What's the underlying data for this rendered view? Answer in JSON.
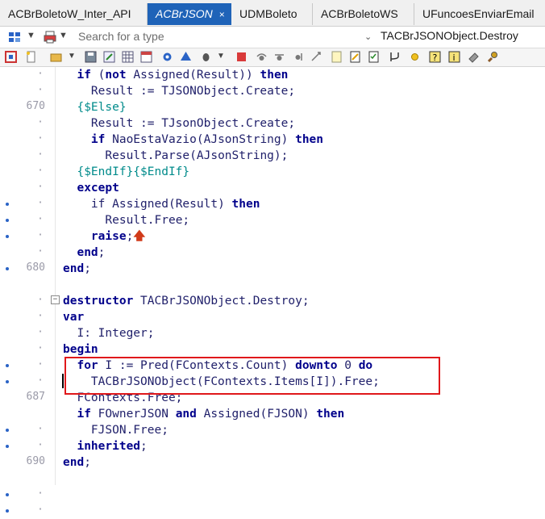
{
  "tabs": [
    {
      "label": "ACBrBoletoW_Inter_API",
      "active": false
    },
    {
      "label": "ACBrJSON",
      "active": true,
      "close": "×"
    },
    {
      "label": "UDMBoleto",
      "active": false
    },
    {
      "label": "ACBrBoletoWS",
      "active": false
    },
    {
      "label": "UFuncoesEnviarEmail",
      "active": false
    }
  ],
  "search": {
    "placeholder": "Search for a type"
  },
  "method_selector": {
    "value": "TACBrJSONObject.Destroy"
  },
  "colors": {
    "tab_active": "#1f63b8",
    "highlight_box": "#e0181b",
    "keyword": "#00008b",
    "directive": "#008b8b"
  },
  "gutter": [
    {
      "num": "",
      "dot": false
    },
    {
      "num": "",
      "dot": false
    },
    {
      "num": "670",
      "dot": false
    },
    {
      "num": "",
      "dot": false
    },
    {
      "num": "",
      "dot": false
    },
    {
      "num": "",
      "dot": false
    },
    {
      "num": "",
      "dot": false
    },
    {
      "num": "",
      "dot": false
    },
    {
      "num": "",
      "dot": true
    },
    {
      "num": "",
      "dot": true
    },
    {
      "num": "",
      "dot": true
    },
    {
      "num": "",
      "dot": false
    },
    {
      "num": "680",
      "dot": true
    },
    {
      "num": "",
      "dot": false
    },
    {
      "num": "",
      "dot": false
    },
    {
      "num": "",
      "dot": false
    },
    {
      "num": "",
      "dot": false
    },
    {
      "num": "",
      "dot": true
    },
    {
      "num": "",
      "dot": true
    },
    {
      "num": "687",
      "dot": false
    },
    {
      "num": "",
      "dot": true
    },
    {
      "num": "",
      "dot": true
    },
    {
      "num": "690",
      "dot": false
    },
    {
      "num": "",
      "dot": true
    },
    {
      "num": "",
      "dot": true
    }
  ],
  "code": {
    "l1": {
      "indent": "  ",
      "a": "if",
      "b": " (",
      "c": "not",
      "d": " Assigned(Result)) ",
      "e": "then"
    },
    "l2": {
      "indent": "    ",
      "a": "Result := TJSONObject.Create;"
    },
    "l3": {
      "indent": "  ",
      "a": "{$Else}"
    },
    "l4": {
      "indent": "    ",
      "a": "Result := TJsonObject.Create;"
    },
    "l5": {
      "indent": "    ",
      "a": "if",
      "b": " NaoEstaVazio(AJsonString) ",
      "c": "then"
    },
    "l6": {
      "indent": "      ",
      "a": "Result.Parse(AJsonString);"
    },
    "l7": {
      "indent": "  ",
      "a": "{$EndIf}{$EndIf}"
    },
    "l8": {
      "indent": "  ",
      "a": "except"
    },
    "l9": {
      "indent": "    ",
      "a": "if",
      "b": " Assigned(Result) ",
      "c": "then"
    },
    "l10": {
      "indent": "      ",
      "a": "Result.Free;"
    },
    "l11": {
      "indent": "    ",
      "a": "raise",
      "b": ";"
    },
    "l12": {
      "indent": "  ",
      "a": "end",
      "b": ";"
    },
    "l13": {
      "indent": "",
      "a": "end",
      "b": ";"
    },
    "l14": {
      "indent": "",
      "a": "destructor",
      "b": " TACBrJSONObject.Destroy;"
    },
    "l15": {
      "indent": "",
      "a": "var"
    },
    "l16": {
      "indent": "  ",
      "a": "I: Integer;"
    },
    "l17": {
      "indent": "",
      "a": "begin"
    },
    "l18": {
      "indent": "  ",
      "a": "for",
      "b": " I := Pred(FContexts.Count) ",
      "c": "downto",
      "d": " 0 ",
      "e": "do"
    },
    "l19": {
      "indent": "    ",
      "a": "TACBrJSONObject(FContexts.Items[I]).Free;"
    },
    "l20": {
      "indent": "  ",
      "a": "FContexts.Free;"
    },
    "l21": {
      "indent": "  ",
      "a": "if",
      "b": " FOwnerJSON ",
      "c": "and",
      "d": " Assigned(FJSON) ",
      "e": "then"
    },
    "l22": {
      "indent": "    ",
      "a": "FJSON.Free;"
    },
    "l23": {
      "indent": "  ",
      "a": "inherited",
      "b": ";"
    },
    "l24": {
      "indent": "",
      "a": "end",
      "b": ";"
    }
  }
}
